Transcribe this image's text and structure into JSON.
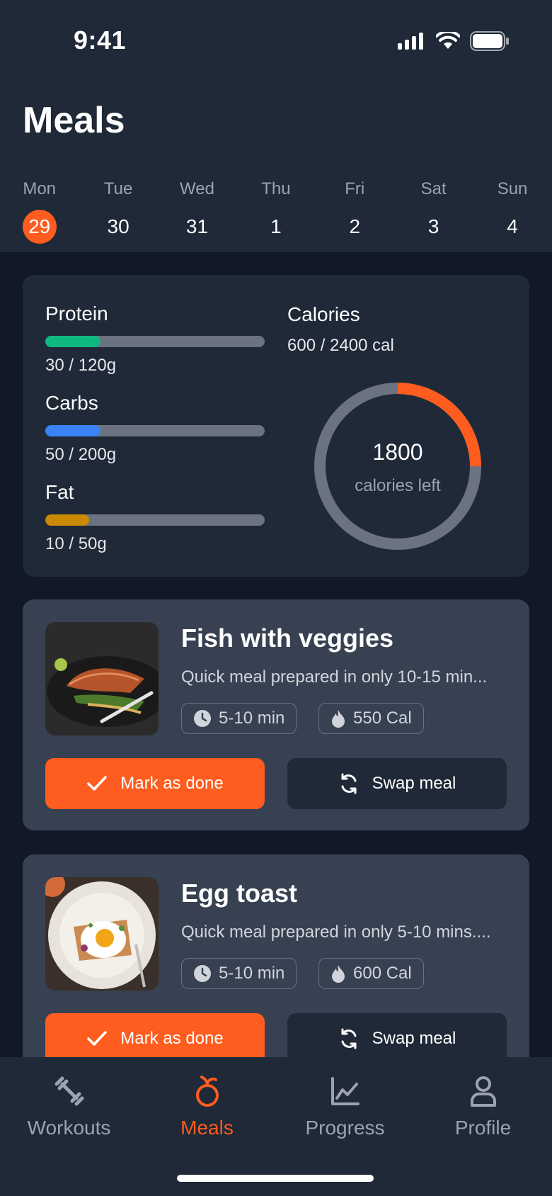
{
  "status": {
    "time": "9:41"
  },
  "page": {
    "title": "Meals"
  },
  "week": [
    {
      "name": "Mon",
      "num": "29",
      "active": true
    },
    {
      "name": "Tue",
      "num": "30"
    },
    {
      "name": "Wed",
      "num": "31"
    },
    {
      "name": "Thu",
      "num": "1"
    },
    {
      "name": "Fri",
      "num": "2"
    },
    {
      "name": "Sat",
      "num": "3"
    },
    {
      "name": "Sun",
      "num": "4"
    }
  ],
  "summary": {
    "macros": [
      {
        "label": "Protein",
        "value": "30 / 120g",
        "progress": 0.25,
        "color": "#10b981"
      },
      {
        "label": "Carbs",
        "value": "50 / 200g",
        "progress": 0.25,
        "color": "#3b82f6"
      },
      {
        "label": "Fat",
        "value": "10 / 50g",
        "progress": 0.2,
        "color": "#ca8a04"
      }
    ],
    "calories_label": "Calories",
    "calories_value": "600 / 2400 cal",
    "calories_progress": 0.25,
    "ring_number": "1800",
    "ring_caption": "calories left"
  },
  "meals": [
    {
      "title": "Fish with veggies",
      "description": "Quick meal prepared in only 10-15 min...",
      "time": "5-10 min",
      "calories": "550 Cal",
      "done_label": "Mark as done",
      "swap_label": "Swap meal"
    },
    {
      "title": "Egg toast",
      "description": "Quick meal prepared in only 5-10 mins....",
      "time": "5-10 min",
      "calories": "600 Cal",
      "done_label": "Mark as done",
      "swap_label": "Swap meal"
    }
  ],
  "tabs": [
    {
      "label": "Workouts",
      "icon": "dumbbell-icon"
    },
    {
      "label": "Meals",
      "icon": "fruit-icon",
      "active": true
    },
    {
      "label": "Progress",
      "icon": "chart-icon"
    },
    {
      "label": "Profile",
      "icon": "user-icon"
    }
  ],
  "colors": {
    "accent": "#ff5c1f",
    "background": "#111827",
    "surface": "#1f2937",
    "card": "#374151"
  }
}
